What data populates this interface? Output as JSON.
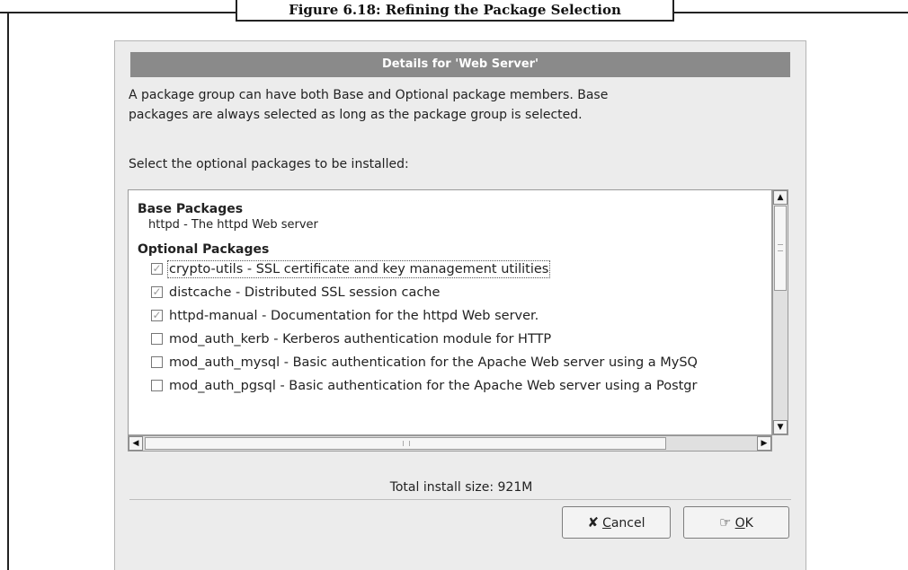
{
  "figure": {
    "caption": "Figure 6.18: Refining the Package Selection"
  },
  "dialog": {
    "title": "Details for 'Web Server'",
    "description_line1": "A package group can have both Base and Optional package members.  Base",
    "description_line2": "packages are always selected as long as the package group is selected.",
    "select_prompt": "Select the optional packages to be installed:",
    "base_heading": "Base Packages",
    "base_packages": [
      "httpd - The httpd Web server"
    ],
    "optional_heading": "Optional Packages",
    "optional_packages": [
      {
        "label": "crypto-utils - SSL certificate and key management utilities",
        "checked": true
      },
      {
        "label": "distcache - Distributed SSL session cache",
        "checked": true
      },
      {
        "label": "httpd-manual - Documentation for the httpd Web server.",
        "checked": true
      },
      {
        "label": "mod_auth_kerb - Kerberos authentication module for HTTP",
        "checked": false
      },
      {
        "label": "mod_auth_mysql - Basic authentication for the Apache Web server using a MySQ",
        "checked": false
      },
      {
        "label": "mod_auth_pgsql - Basic authentication for the Apache Web server using a Postgr",
        "checked": false
      }
    ],
    "total_size_text": "Total install size: 921M",
    "buttons": {
      "cancel": {
        "label": "ancel",
        "mnemonic": "C",
        "icon": "cancel-x-icon"
      },
      "ok": {
        "label": "K",
        "mnemonic": "O",
        "icon": "ok-hand-icon"
      }
    },
    "check_mark": "✓"
  }
}
